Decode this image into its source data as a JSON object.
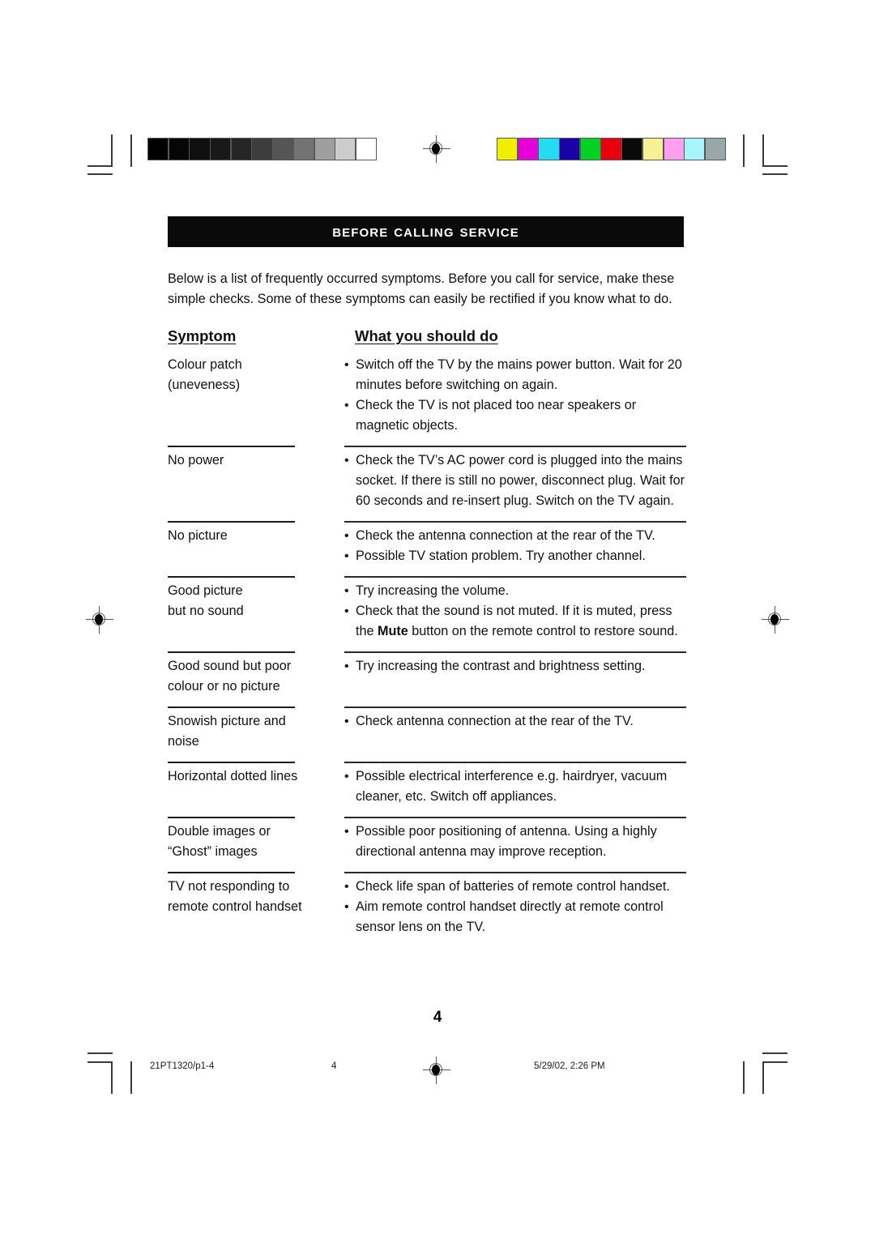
{
  "document": {
    "header_title": "Before Calling Service",
    "intro": "Below is a list of frequently occurred symptoms. Before you call for service, make these simple checks. Some of these symptoms can easily be rectified if you know what to do.",
    "page_number": "4"
  },
  "table": {
    "headers": {
      "symptom": "Symptom",
      "action": "What you should do"
    },
    "rows": [
      {
        "symptom": "Colour patch\n(uneveness)",
        "actions": [
          {
            "text": "Switch off the TV by the mains power button. Wait for 20 minutes before switching on again."
          },
          {
            "text": "Check the TV is not placed too near speakers or magnetic objects."
          }
        ]
      },
      {
        "symptom": "No power",
        "actions": [
          {
            "text": "Check the TV’s AC power cord is plugged into the mains socket. If there is still no power, disconnect plug. Wait for 60 seconds and re-insert plug. Switch on the TV again."
          }
        ]
      },
      {
        "symptom": "No picture",
        "actions": [
          {
            "text": "Check the antenna connection at the rear of the TV."
          },
          {
            "text": "Possible TV station problem. Try another channel."
          }
        ]
      },
      {
        "symptom": "Good picture\nbut no sound",
        "actions": [
          {
            "text": "Try increasing the volume."
          },
          {
            "pre": "Check that the sound is not muted. If it is muted, press the ",
            "bold": "Mute",
            "post": " button on the remote control to restore sound."
          }
        ]
      },
      {
        "symptom": "Good sound but poor\ncolour or no picture",
        "actions": [
          {
            "text": "Try increasing the contrast and brightness setting."
          }
        ]
      },
      {
        "symptom": "Snowish picture and\nnoise",
        "actions": [
          {
            "text": "Check antenna connection at the rear of the TV."
          }
        ]
      },
      {
        "symptom": "Horizontal dotted lines",
        "actions": [
          {
            "text": "Possible electrical interference e.g. hairdryer, vacuum cleaner, etc. Switch off appliances."
          }
        ]
      },
      {
        "symptom": "Double images or\n“Ghost” images",
        "actions": [
          {
            "text": "Possible poor positioning of antenna. Using a highly directional  antenna may improve reception."
          }
        ]
      },
      {
        "symptom": "TV not responding to\nremote control handset",
        "actions": [
          {
            "text": "Check life span of batteries of remote control handset."
          },
          {
            "text": "Aim remote control handset directly at remote control sensor lens on the TV."
          }
        ]
      }
    ],
    "bullet_glyph": "•"
  },
  "footer": {
    "doc_id": "21PT1320/p1-4",
    "page": "4",
    "timestamp": "5/29/02, 2:26 PM"
  },
  "print_marks": {
    "grayscale_bar": {
      "label": "grayscale-calibration-bar",
      "swatches": [
        "#000000",
        "#060606",
        "#0f0f0f",
        "#191919",
        "#262626",
        "#3d3d3d",
        "#555555",
        "#737373",
        "#9e9e9e",
        "#cccccc",
        "#ffffff"
      ]
    },
    "colour_bar": {
      "label": "colour-calibration-bar",
      "swatches": [
        "#f2ee00",
        "#e800d8",
        "#24dcf2",
        "#1a02aa",
        "#00d321",
        "#e8000f",
        "#0a0a0a",
        "#f7f095",
        "#ffa0ef",
        "#a6f4fc",
        "#9aa7a8"
      ]
    }
  }
}
